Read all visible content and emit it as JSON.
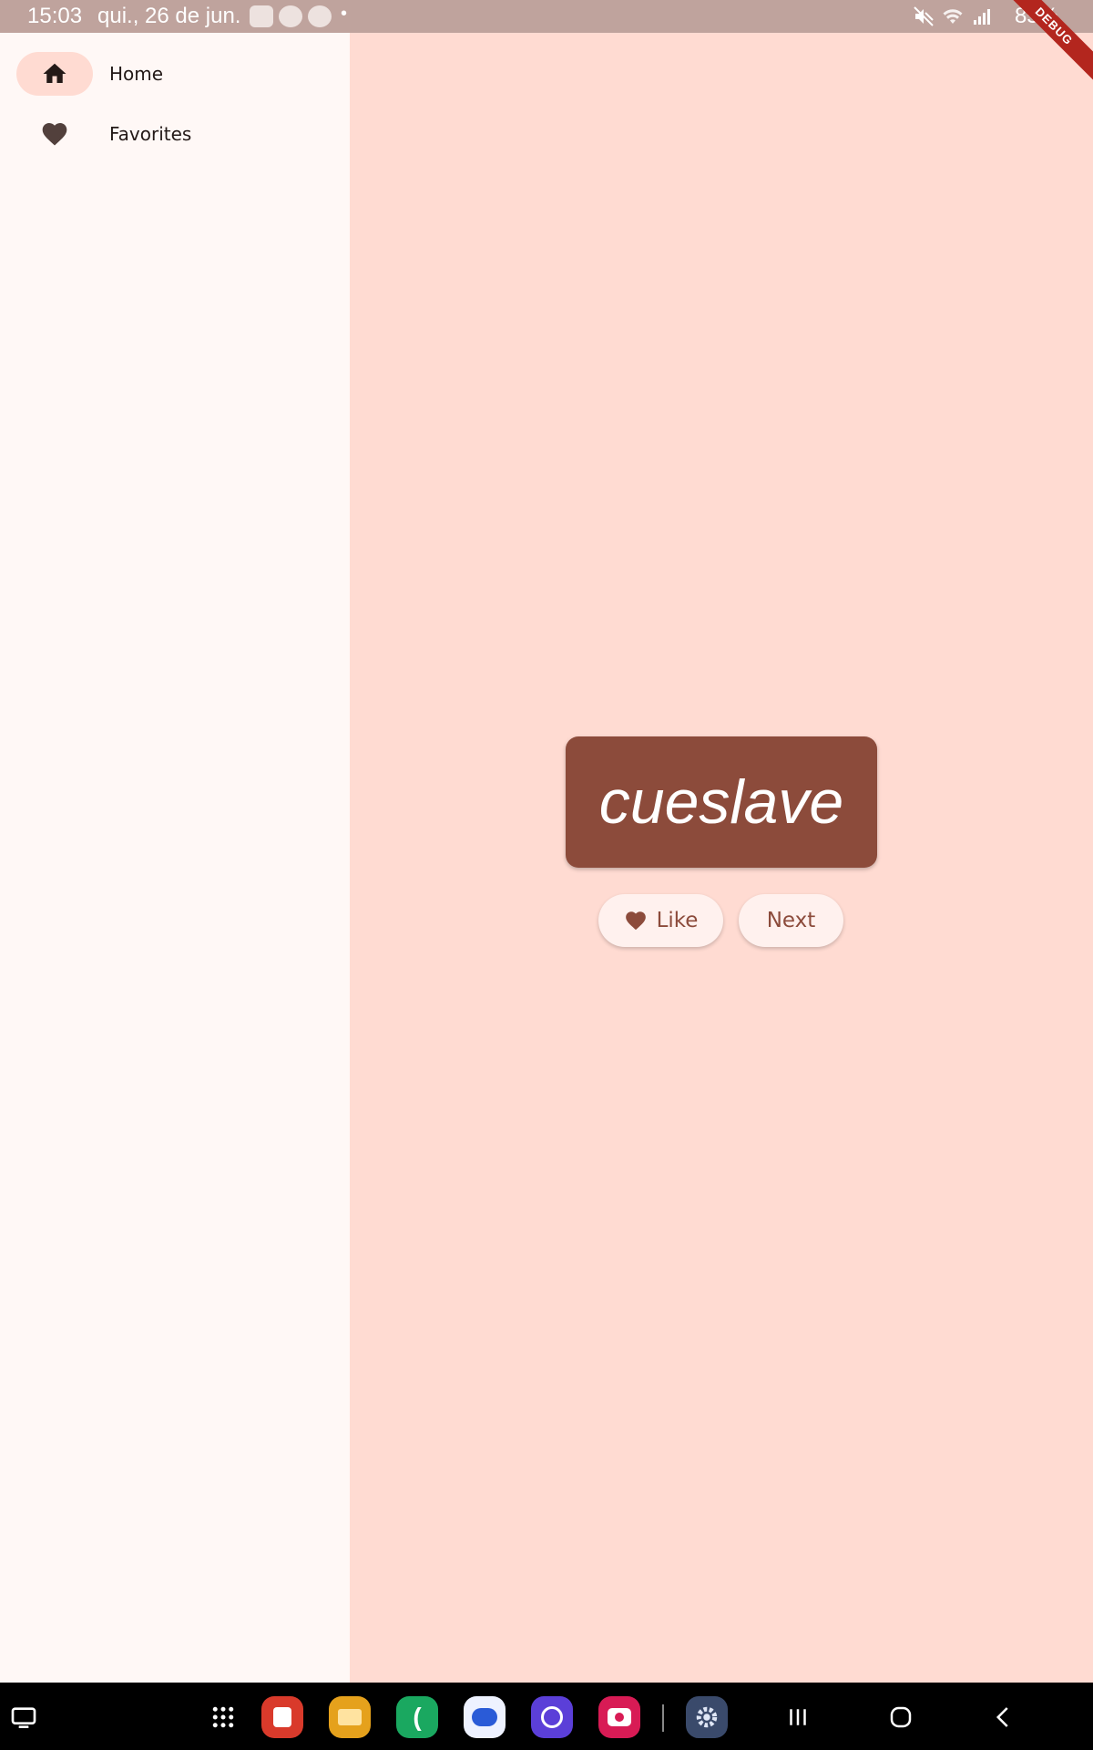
{
  "status_bar": {
    "time": "15:03",
    "date": "qui., 26 de jun.",
    "battery": "85%"
  },
  "debug_banner": "DEBUG",
  "nav": {
    "items": [
      {
        "label": "Home",
        "icon": "home-icon",
        "selected": true
      },
      {
        "label": "Favorites",
        "icon": "heart-icon",
        "selected": false
      }
    ]
  },
  "main": {
    "word": "cueslave",
    "like_label": "Like",
    "next_label": "Next"
  },
  "colors": {
    "primary": "#8c4b3b",
    "background": "#ffdbd2",
    "rail_background": "#fff8f6",
    "button_background": "#fff1ee"
  },
  "taskbar": {
    "apps": [
      "app-drawer-icon",
      "notes-app-icon",
      "files-app-icon",
      "phone-app-icon",
      "messages-app-icon",
      "internet-app-icon",
      "camera-app-icon",
      "settings-app-icon"
    ],
    "nav_buttons": [
      "recents-icon",
      "home-circle-icon",
      "back-icon"
    ]
  }
}
